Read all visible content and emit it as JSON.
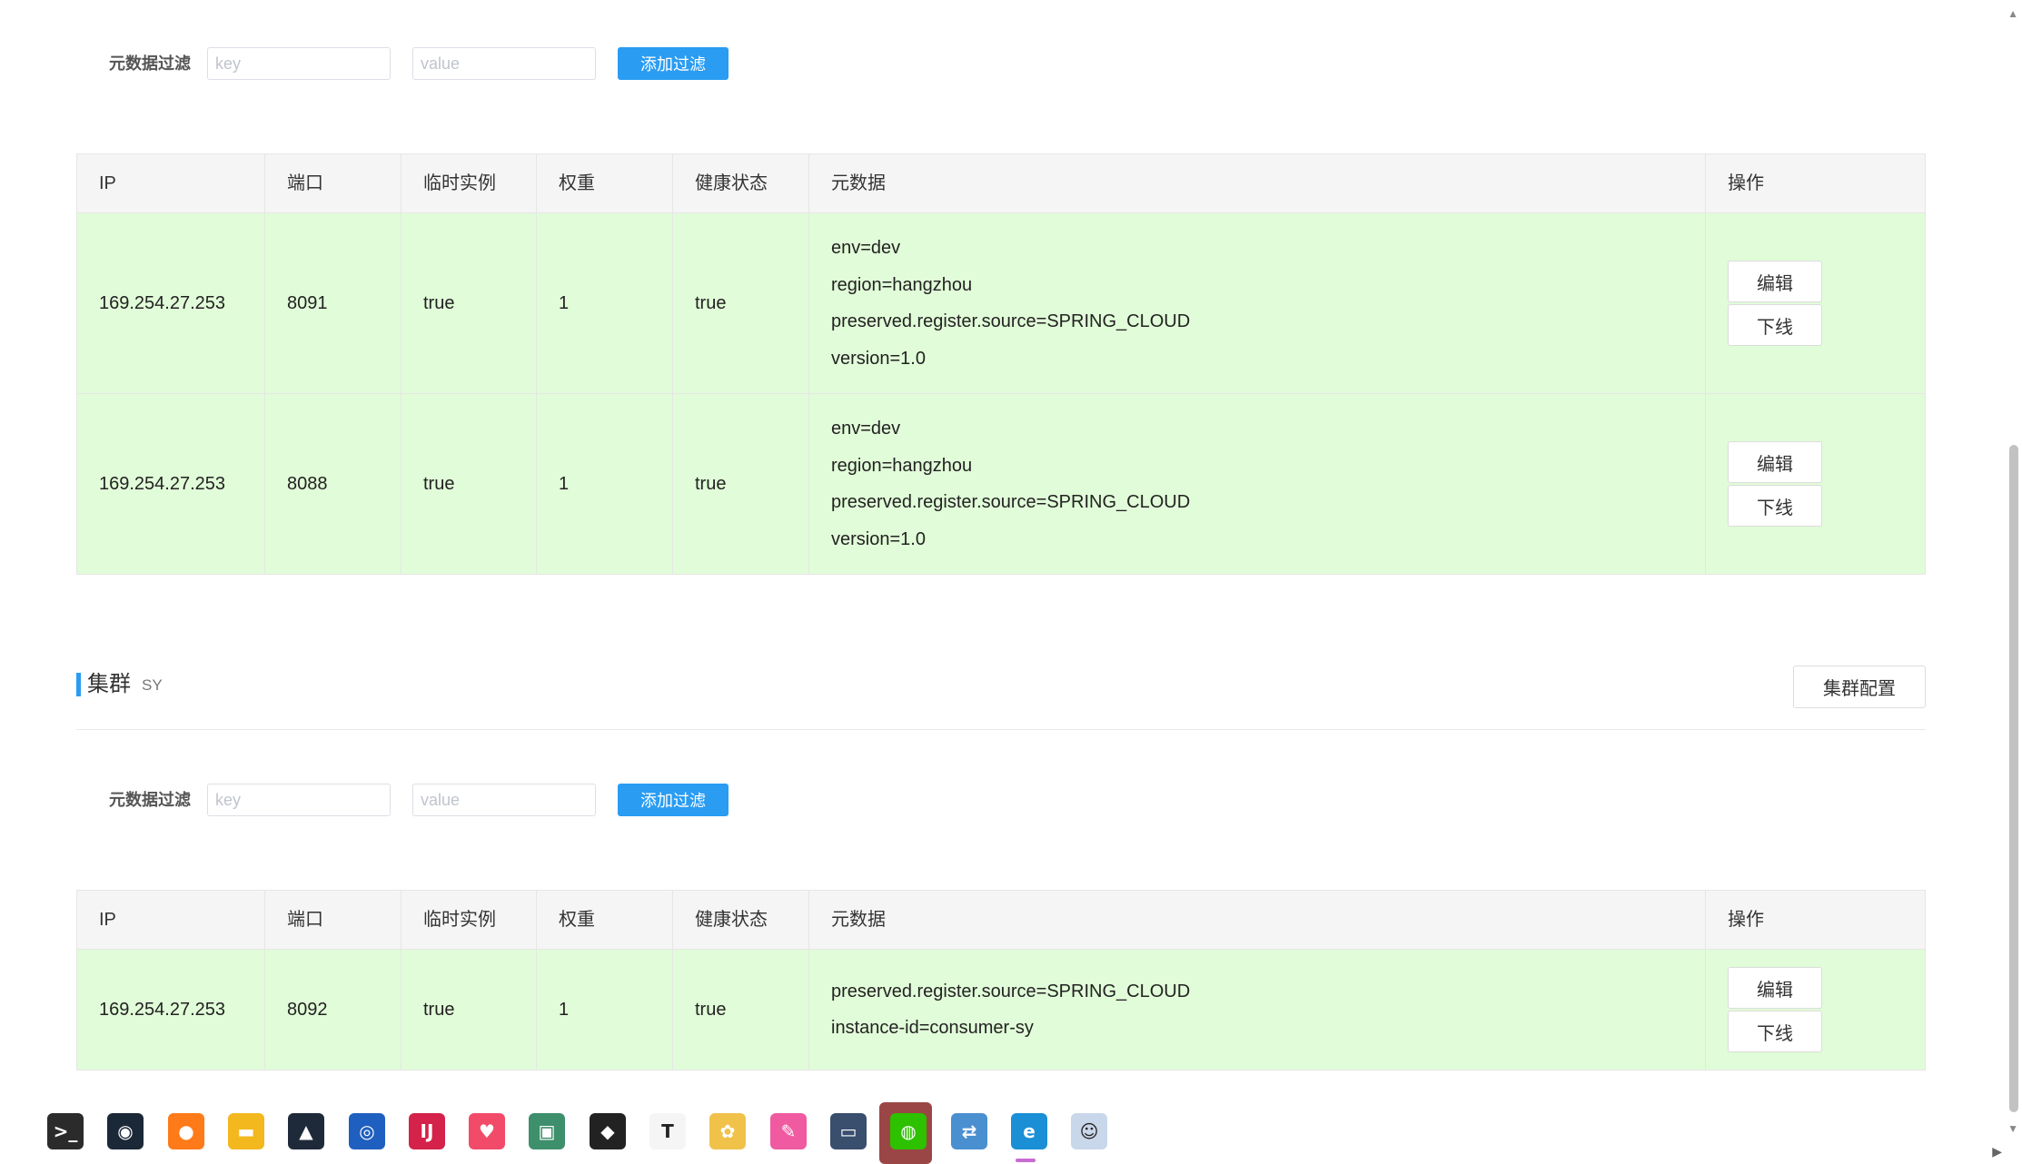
{
  "filter": {
    "label": "元数据过滤",
    "key_placeholder": "key",
    "value_placeholder": "value",
    "button_label": "添加过滤"
  },
  "table_headers": {
    "ip": "IP",
    "port": "端口",
    "ephemeral": "临时实例",
    "weight": "权重",
    "healthy": "健康状态",
    "metadata": "元数据",
    "ops": "操作"
  },
  "ops_labels": {
    "edit": "编辑",
    "offline": "下线"
  },
  "table1": {
    "rows": [
      {
        "ip": "169.254.27.253",
        "port": "8091",
        "ephemeral": "true",
        "weight": "1",
        "healthy": "true",
        "metadata": [
          "env=dev",
          "region=hangzhou",
          "preserved.register.source=SPRING_CLOUD",
          "version=1.0"
        ]
      },
      {
        "ip": "169.254.27.253",
        "port": "8088",
        "ephemeral": "true",
        "weight": "1",
        "healthy": "true",
        "metadata": [
          "env=dev",
          "region=hangzhou",
          "preserved.register.source=SPRING_CLOUD",
          "version=1.0"
        ]
      }
    ]
  },
  "cluster": {
    "title": "集群",
    "name": "SY",
    "config_button": "集群配置"
  },
  "table2": {
    "rows": [
      {
        "ip": "169.254.27.253",
        "port": "8092",
        "ephemeral": "true",
        "weight": "1",
        "healthy": "true",
        "metadata": [
          "preserved.register.source=SPRING_CLOUD",
          "instance-id=consumer-sy"
        ]
      }
    ]
  },
  "taskbar": {
    "apps": [
      {
        "name": "terminal-icon",
        "glyph": ">_",
        "color": "#2b2b2b"
      },
      {
        "name": "steam-icon",
        "glyph": "◉",
        "color": "#1b2838"
      },
      {
        "name": "firefox-icon",
        "glyph": "●",
        "color": "#ff7a18"
      },
      {
        "name": "file-explorer-icon",
        "glyph": "▬",
        "color": "#f3b81e"
      },
      {
        "name": "cat-app-icon",
        "glyph": "▲",
        "color": "#1e2a3a"
      },
      {
        "name": "screenshot-icon",
        "glyph": "◎",
        "color": "#1f5fbf"
      },
      {
        "name": "intellij-icon",
        "glyph": "IJ",
        "color": "#d4224a"
      },
      {
        "name": "heart-app-icon",
        "glyph": "♥",
        "color": "#f24b6a"
      },
      {
        "name": "window-app-icon",
        "glyph": "▣",
        "color": "#3e8f6b"
      },
      {
        "name": "cube-app-icon",
        "glyph": "◆",
        "color": "#222222"
      },
      {
        "name": "typora-icon",
        "glyph": "T",
        "color": "#f5f5f5"
      },
      {
        "name": "flower-app-icon",
        "glyph": "✿",
        "color": "#f0c24a"
      },
      {
        "name": "pen-app-icon",
        "glyph": "✎",
        "color": "#f05aa0"
      },
      {
        "name": "monitor-app-icon",
        "glyph": "▭",
        "color": "#3a4e6e"
      },
      {
        "name": "wechat-icon",
        "glyph": "◍",
        "color": "#2dc100"
      },
      {
        "name": "network-app-icon",
        "glyph": "⇄",
        "color": "#4a8fd0"
      },
      {
        "name": "edge-icon",
        "glyph": "e",
        "color": "#1a8fd6"
      },
      {
        "name": "avatar-app-icon",
        "glyph": "☺",
        "color": "#c9d7ea"
      }
    ]
  }
}
